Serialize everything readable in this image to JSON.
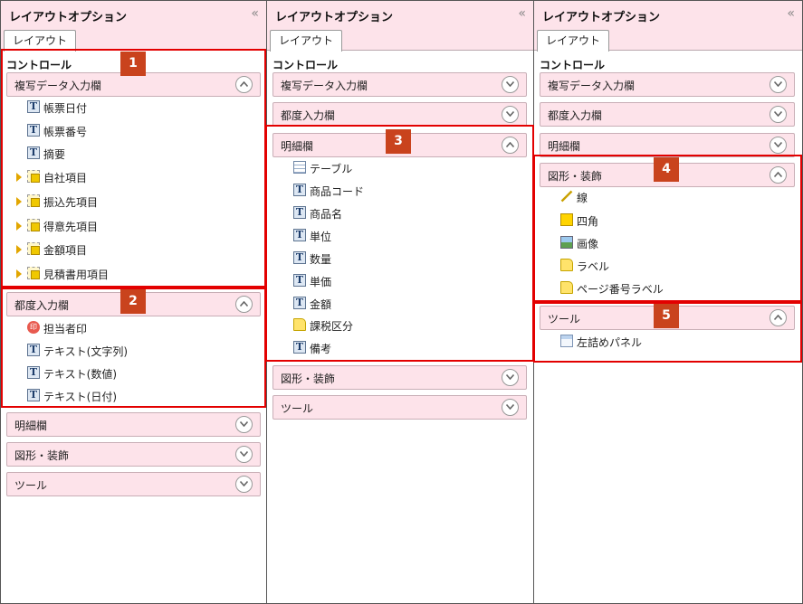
{
  "panels": [
    {
      "title": "レイアウトオプション",
      "collapse_glyph": "«",
      "tab": "レイアウト",
      "section": "コントロール",
      "acc": {
        "fukusha": "複写データ入力欄",
        "tsudo": "都度入力欄",
        "meisai": "明細欄",
        "zukei": "図形・装飾",
        "tool": "ツール"
      },
      "fukusha_items": [
        "帳票日付",
        "帳票番号",
        "摘要"
      ],
      "group_items": [
        "自社項目",
        "振込先項目",
        "得意先項目",
        "金額項目",
        "見積書用項目"
      ],
      "tsudo_items": [
        "担当者印",
        "テキスト(文字列)",
        "テキスト(数値)",
        "テキスト(日付)"
      ],
      "seal_char": "印",
      "t_glyph": "T"
    },
    {
      "title": "レイアウトオプション",
      "collapse_glyph": "«",
      "tab": "レイアウト",
      "section": "コントロール",
      "acc": {
        "fukusha": "複写データ入力欄",
        "tsudo": "都度入力欄",
        "meisai": "明細欄",
        "zukei": "図形・装飾",
        "tool": "ツール"
      },
      "meisai_items": [
        "テーブル",
        "商品コード",
        "商品名",
        "単位",
        "数量",
        "単価",
        "金額",
        "課税区分",
        "備考"
      ],
      "t_glyph": "T"
    },
    {
      "title": "レイアウトオプション",
      "collapse_glyph": "«",
      "tab": "レイアウト",
      "section": "コントロール",
      "acc": {
        "fukusha": "複写データ入力欄",
        "tsudo": "都度入力欄",
        "meisai": "明細欄",
        "zukei": "図形・装飾",
        "tool": "ツール"
      },
      "zukei_items": [
        "線",
        "四角",
        "画像",
        "ラベル",
        "ページ番号ラベル"
      ],
      "tool_items": [
        "左詰めパネル"
      ]
    }
  ],
  "badges": [
    "1",
    "2",
    "3",
    "4",
    "5"
  ],
  "colors": {
    "highlight": "#e30000",
    "badge": "#c9431d",
    "accordion_bg": "#fde3ea"
  }
}
